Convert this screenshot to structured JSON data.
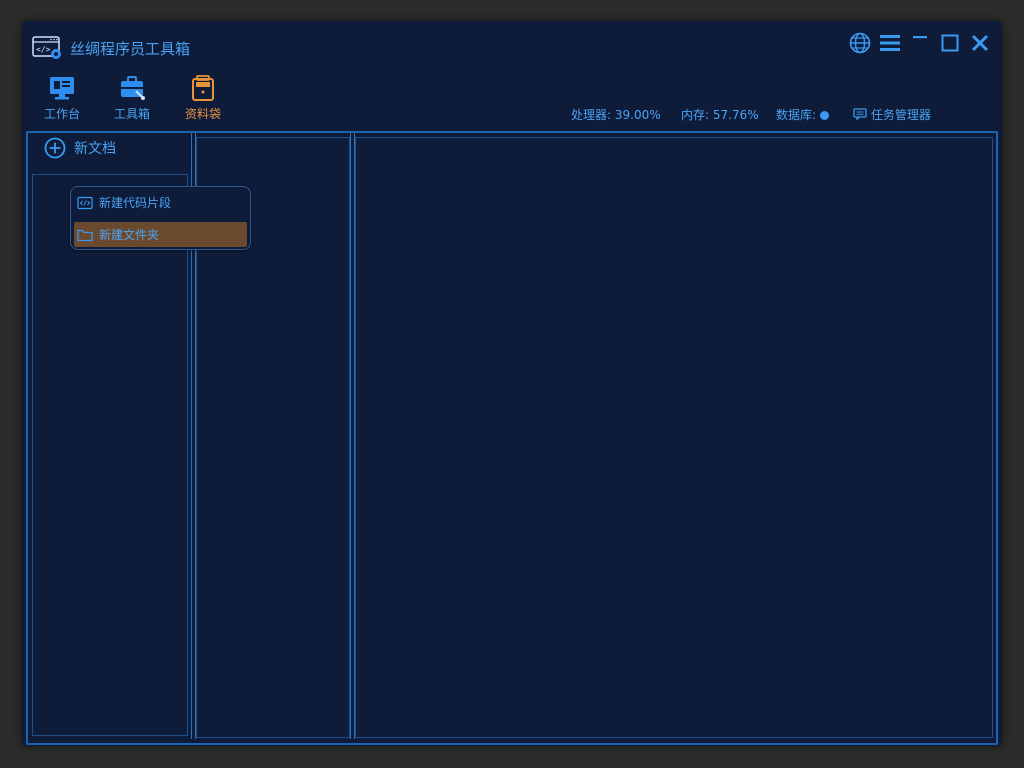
{
  "app": {
    "title": "丝绸程序员工具箱"
  },
  "toolbar": {
    "items": [
      {
        "label": "工作台",
        "icon": "desktop-icon"
      },
      {
        "label": "工具箱",
        "icon": "toolbox-icon"
      },
      {
        "label": "资料袋",
        "icon": "bag-icon",
        "active": true
      }
    ]
  },
  "status": {
    "cpu": "处理器: 39.00%",
    "memory": "内存: 57.76%",
    "database": "数据库:",
    "task_manager": "任务管理器"
  },
  "sidebar": {
    "new_doc_label": "新文档"
  },
  "context_menu": {
    "items": [
      {
        "label": "新建代码片段",
        "icon": "code-icon"
      },
      {
        "label": "新建文件夹",
        "icon": "folder-icon",
        "highlighted": true
      }
    ]
  },
  "colors": {
    "background": "#0e1c3a",
    "accent": "#4aa3f5",
    "active": "#e8923a",
    "highlight": "#6a4a2e"
  }
}
